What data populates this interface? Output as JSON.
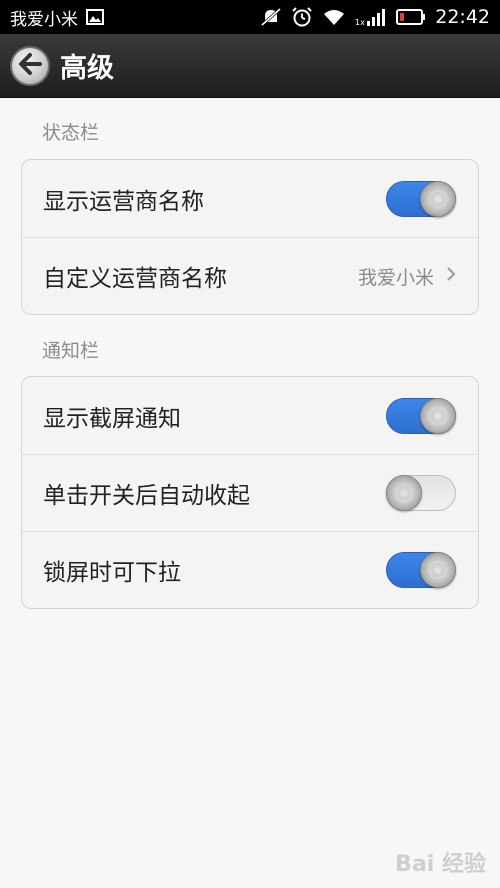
{
  "status_bar": {
    "carrier": "我爱小米",
    "time": "22:42",
    "icons": [
      "image-icon",
      "mute-icon",
      "alarm-icon",
      "wifi-icon",
      "signal-icon",
      "battery-icon"
    ]
  },
  "header": {
    "title": "高级",
    "back_icon": "back-arrow-icon"
  },
  "sections": [
    {
      "title": "状态栏",
      "rows": [
        {
          "label": "显示运营商名称",
          "type": "toggle",
          "on": true
        },
        {
          "label": "自定义运营商名称",
          "type": "value",
          "value": "我爱小米",
          "icon": "chevron-right-icon"
        }
      ]
    },
    {
      "title": "通知栏",
      "rows": [
        {
          "label": "显示截屏通知",
          "type": "toggle",
          "on": true
        },
        {
          "label": "单击开关后自动收起",
          "type": "toggle",
          "on": false
        },
        {
          "label": "锁屏时可下拉",
          "type": "toggle",
          "on": true
        }
      ]
    }
  ],
  "watermark": "Bai 经验",
  "colors": {
    "toggle_on": "#3d86e8",
    "toggle_off": "#e2e2e2",
    "title_bar": "#2b2b2b"
  }
}
